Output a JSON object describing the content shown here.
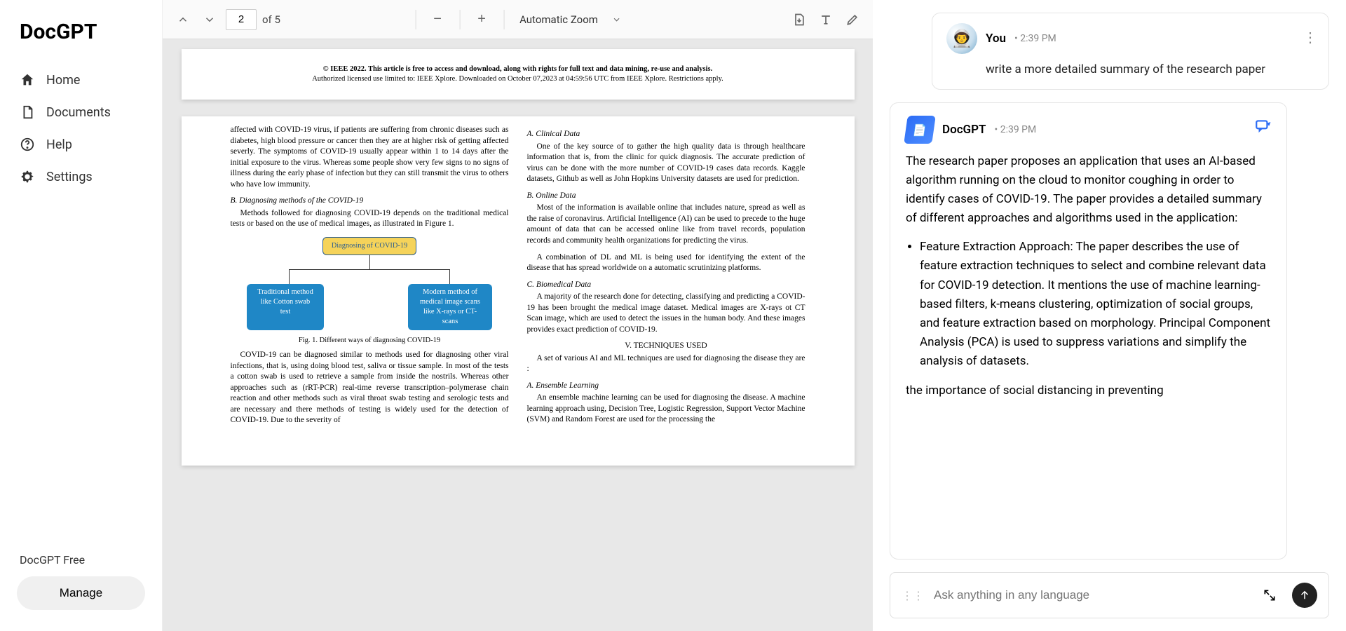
{
  "app": {
    "name": "DocGPT"
  },
  "sidebar": {
    "items": [
      {
        "label": "Home"
      },
      {
        "label": "Documents"
      },
      {
        "label": "Help"
      },
      {
        "label": "Settings"
      }
    ],
    "plan": "DocGPT Free",
    "manage": "Manage"
  },
  "viewer": {
    "page_current": "2",
    "page_total": "of 5",
    "zoom_label": "Automatic Zoom",
    "stub_line1": "© IEEE 2022. This article is free to access and download, along with rights for full text and data mining, re-use and analysis.",
    "stub_line2": "Authorized licensed use limited to: IEEE Xplore. Downloaded on October 07,2023 at 04:59:56 UTC from IEEE Xplore.  Restrictions apply.",
    "left": {
      "p1": "affected with COVID-19 virus, if patients are suffering from chronic diseases such as diabetes, high blood pressure or cancer then they are at higher risk of getting affected severly. The symptoms of COVID-19 usually appear within 1 to 14 days after the initial exposure to the virus. Whereas some people show  very few signs to no signs of illness during the early phase of infection but they can still transmit the virus to others who have low immunity.",
      "h2": "B.    Diagnosing methods of the COVID-19",
      "p2": "Methods followed for diagnosing COVID-19 depends on the traditional medical tests or  based on the use of medical images, as illustrated in Figure 1.",
      "fig_top": "Diagnosing of COVID-19",
      "fig_left": "Traditional method like Cotton swab test",
      "fig_right": "Modern method of medical image scans like X-rays or CT-scans",
      "fig_caption": "Fig. 1.    Different ways of diagnosing COVID-19",
      "p3": "COVID-19 can be diagnosed similar to methods used for diagnosing  other viral infections, that is, using doing blood test, saliva or tissue sample. In most of the tests a cotton swab is used to retrieve a sample from inside the nostrils. Whereas other approaches such as (rRT-PCR) real-time reverse transcription–polymerase chain reaction and other methods such as viral throat swab testing and serologic tests and are necessary and there methods of testing is widely used for the detection of COVID-19. Due to the severity of"
    },
    "right": {
      "hA": "A.    Clinical Data",
      "pA": "One of the key source of to gather the high quality data is through healthcare information that is, from the clinic for quick diagnosis. The accurate prediction of virus can be done with the more number of COVID-19 cases data records. Kaggle datasets, Github as well as John Hopkins University datasets are used for prediction.",
      "hB": "B.    Online Data",
      "pB1": "Most of the information is available online that includes nature, spread as well as the raise of coronavirus. Artificial Intelligence  (AI) can be used to precede to the huge amount of data that can be accessed online like from travel records, population records and community health organizations for predicting the virus.",
      "pB2": "A combination of DL and ML is being used for identifying the extent of the disease that has spread worldwide on a automatic scrutinizing platforms.",
      "hC": "C.    Biomedical Data",
      "pC": "A majority of the research done for detecting, classifying and predicting a COVID-19 has been brought the medical image dataset. Medical images are X-rays ot CT Scan image, which are used to detect the issues in the human body. And these images provides exact prediction of COVID-19.",
      "hV": "V.      TECHNIQUES USED",
      "pV": "A set of various AI and ML techniques are used for diagnosing the disease they are :",
      "hAe": "A.    Ensemble Learning",
      "pAe": "An ensemble machine learning can be used for diagnosing the disease. A machine learning approach using, Decision Tree, Logistic Regression, Support Vector Machine (SVM) and Random Forest are used for the processing the"
    }
  },
  "chat": {
    "user": {
      "name": "You",
      "time": "• 2:39 PM",
      "text": "write a more detailed summary of the research paper"
    },
    "bot": {
      "name": "DocGPT",
      "time": "• 2:39 PM",
      "intro": "The research paper proposes an application that uses an AI-based algorithm running on the cloud to monitor coughing in order to identify cases of COVID-19. The paper provides a detailed summary of different approaches and algorithms used in the application:",
      "bullet1": "Feature Extraction Approach: The paper describes the use of feature extraction techniques to select and combine relevant data for COVID-19 detection. It mentions the use of machine learning-based filters, k-means clustering, optimization of social groups, and feature extraction based on morphology. Principal Component Analysis (PCA) is used to suppress variations and simplify the analysis of datasets.",
      "bullet2": "the importance of social distancing in preventing"
    },
    "input_placeholder": "Ask anything in any language"
  }
}
